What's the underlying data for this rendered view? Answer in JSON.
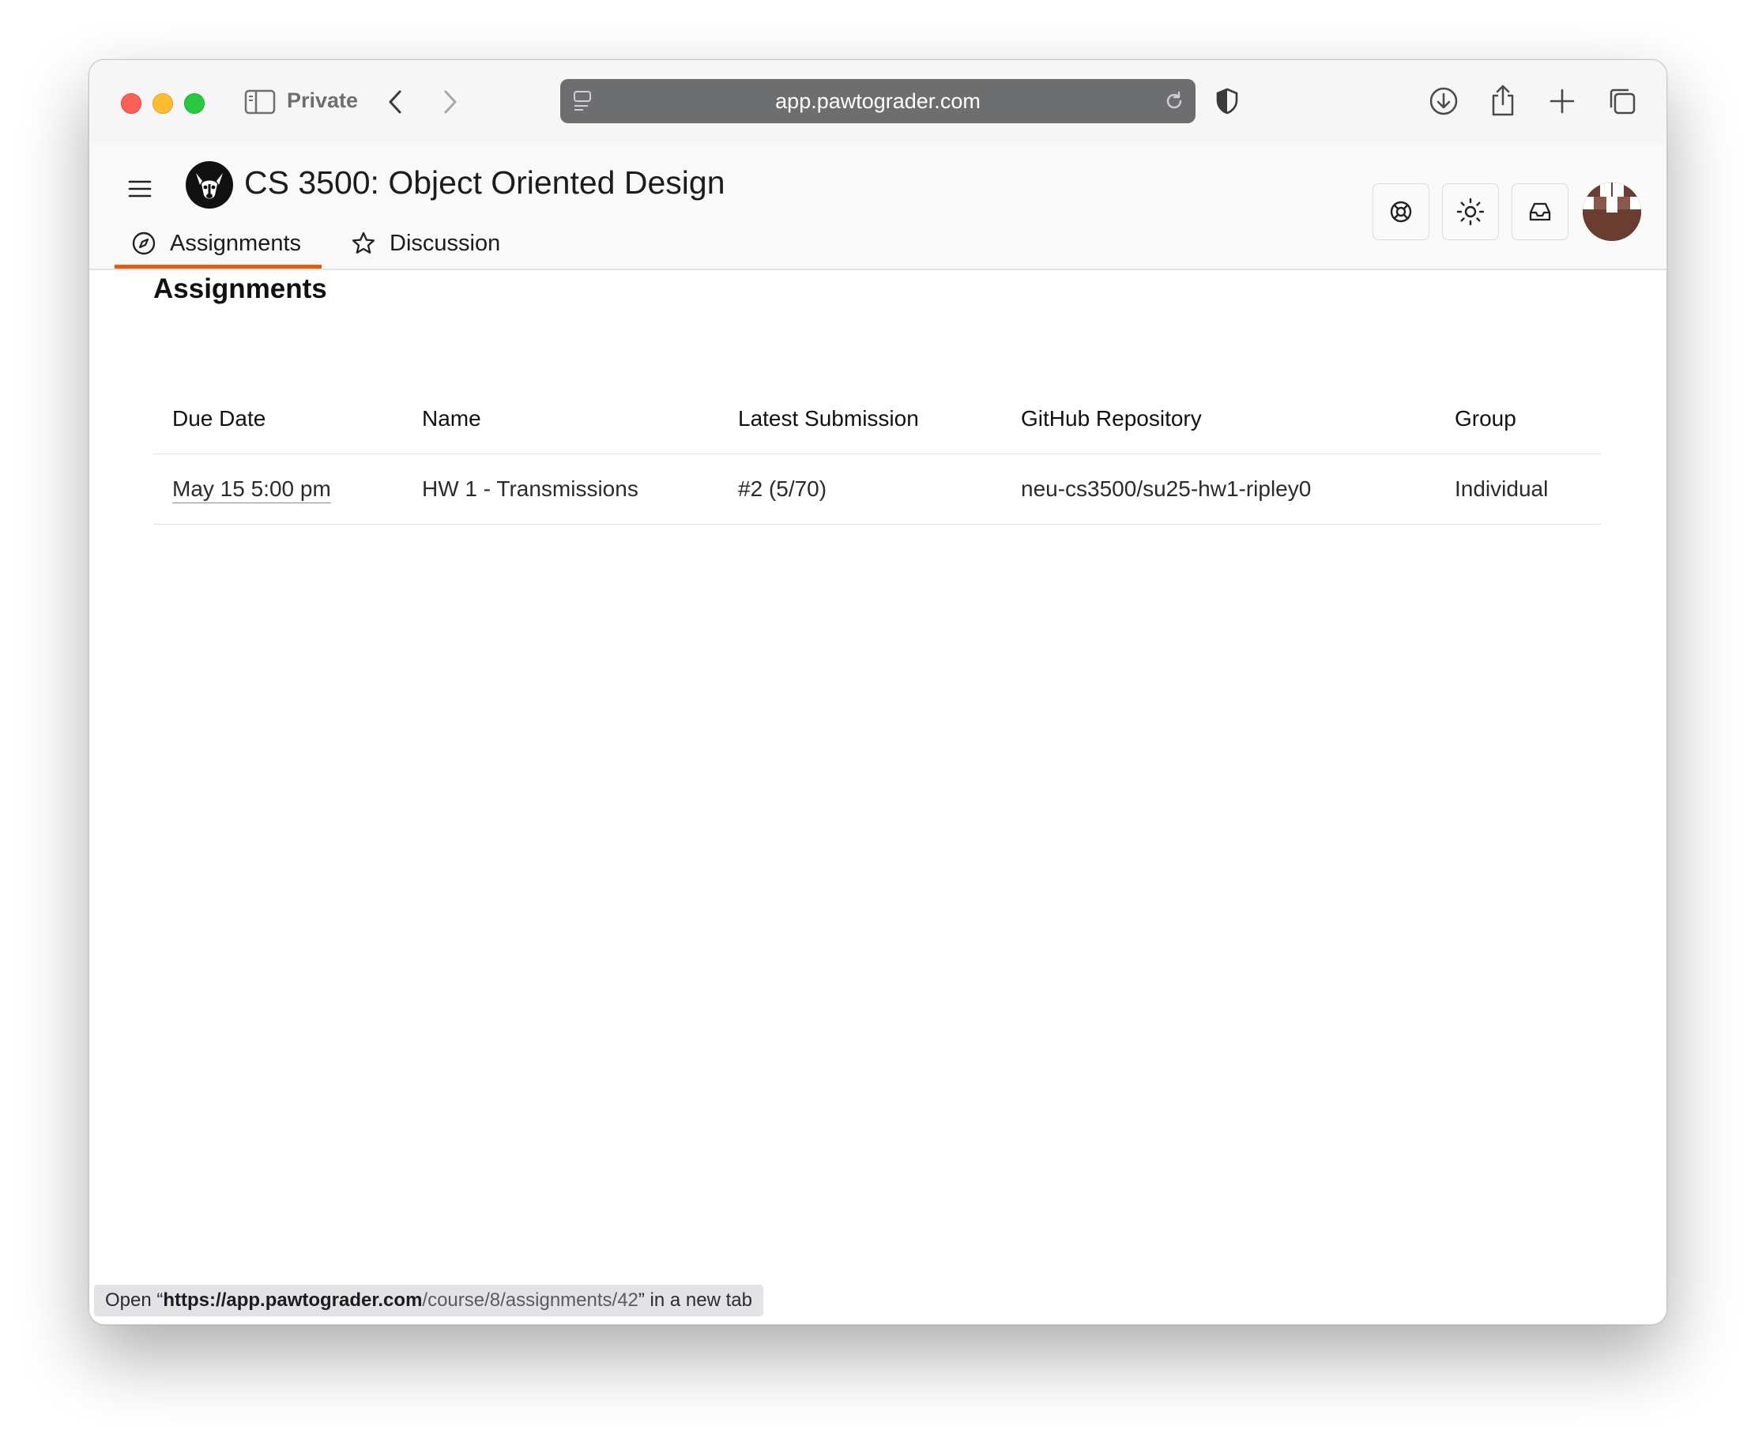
{
  "browser": {
    "private_label": "Private",
    "url": "app.pawtograder.com",
    "status_prefix": "Open “",
    "status_host": "https://app.pawtograder.com",
    "status_path": "/course/8/assignments/42",
    "status_suffix": "” in a new tab"
  },
  "header": {
    "course_title": "CS 3500: Object Oriented Design",
    "tabs": [
      {
        "label": "Assignments",
        "icon": "compass-icon",
        "active": true
      },
      {
        "label": "Discussion",
        "icon": "star-icon",
        "active": false
      }
    ],
    "actions": [
      "help-icon",
      "theme-icon",
      "inbox-icon"
    ],
    "accent_color": "#e8590c"
  },
  "main": {
    "title": "Assignments",
    "columns": [
      "Due Date",
      "Name",
      "Latest Submission",
      "GitHub Repository",
      "Group"
    ],
    "rows": [
      {
        "due_date": "May 15 5:00 pm",
        "name": "HW 1 - Transmissions",
        "latest_submission": "#2 (5/70)",
        "repository": "neu-cs3500/su25-hw1-ripley0",
        "group": "Individual"
      }
    ]
  }
}
